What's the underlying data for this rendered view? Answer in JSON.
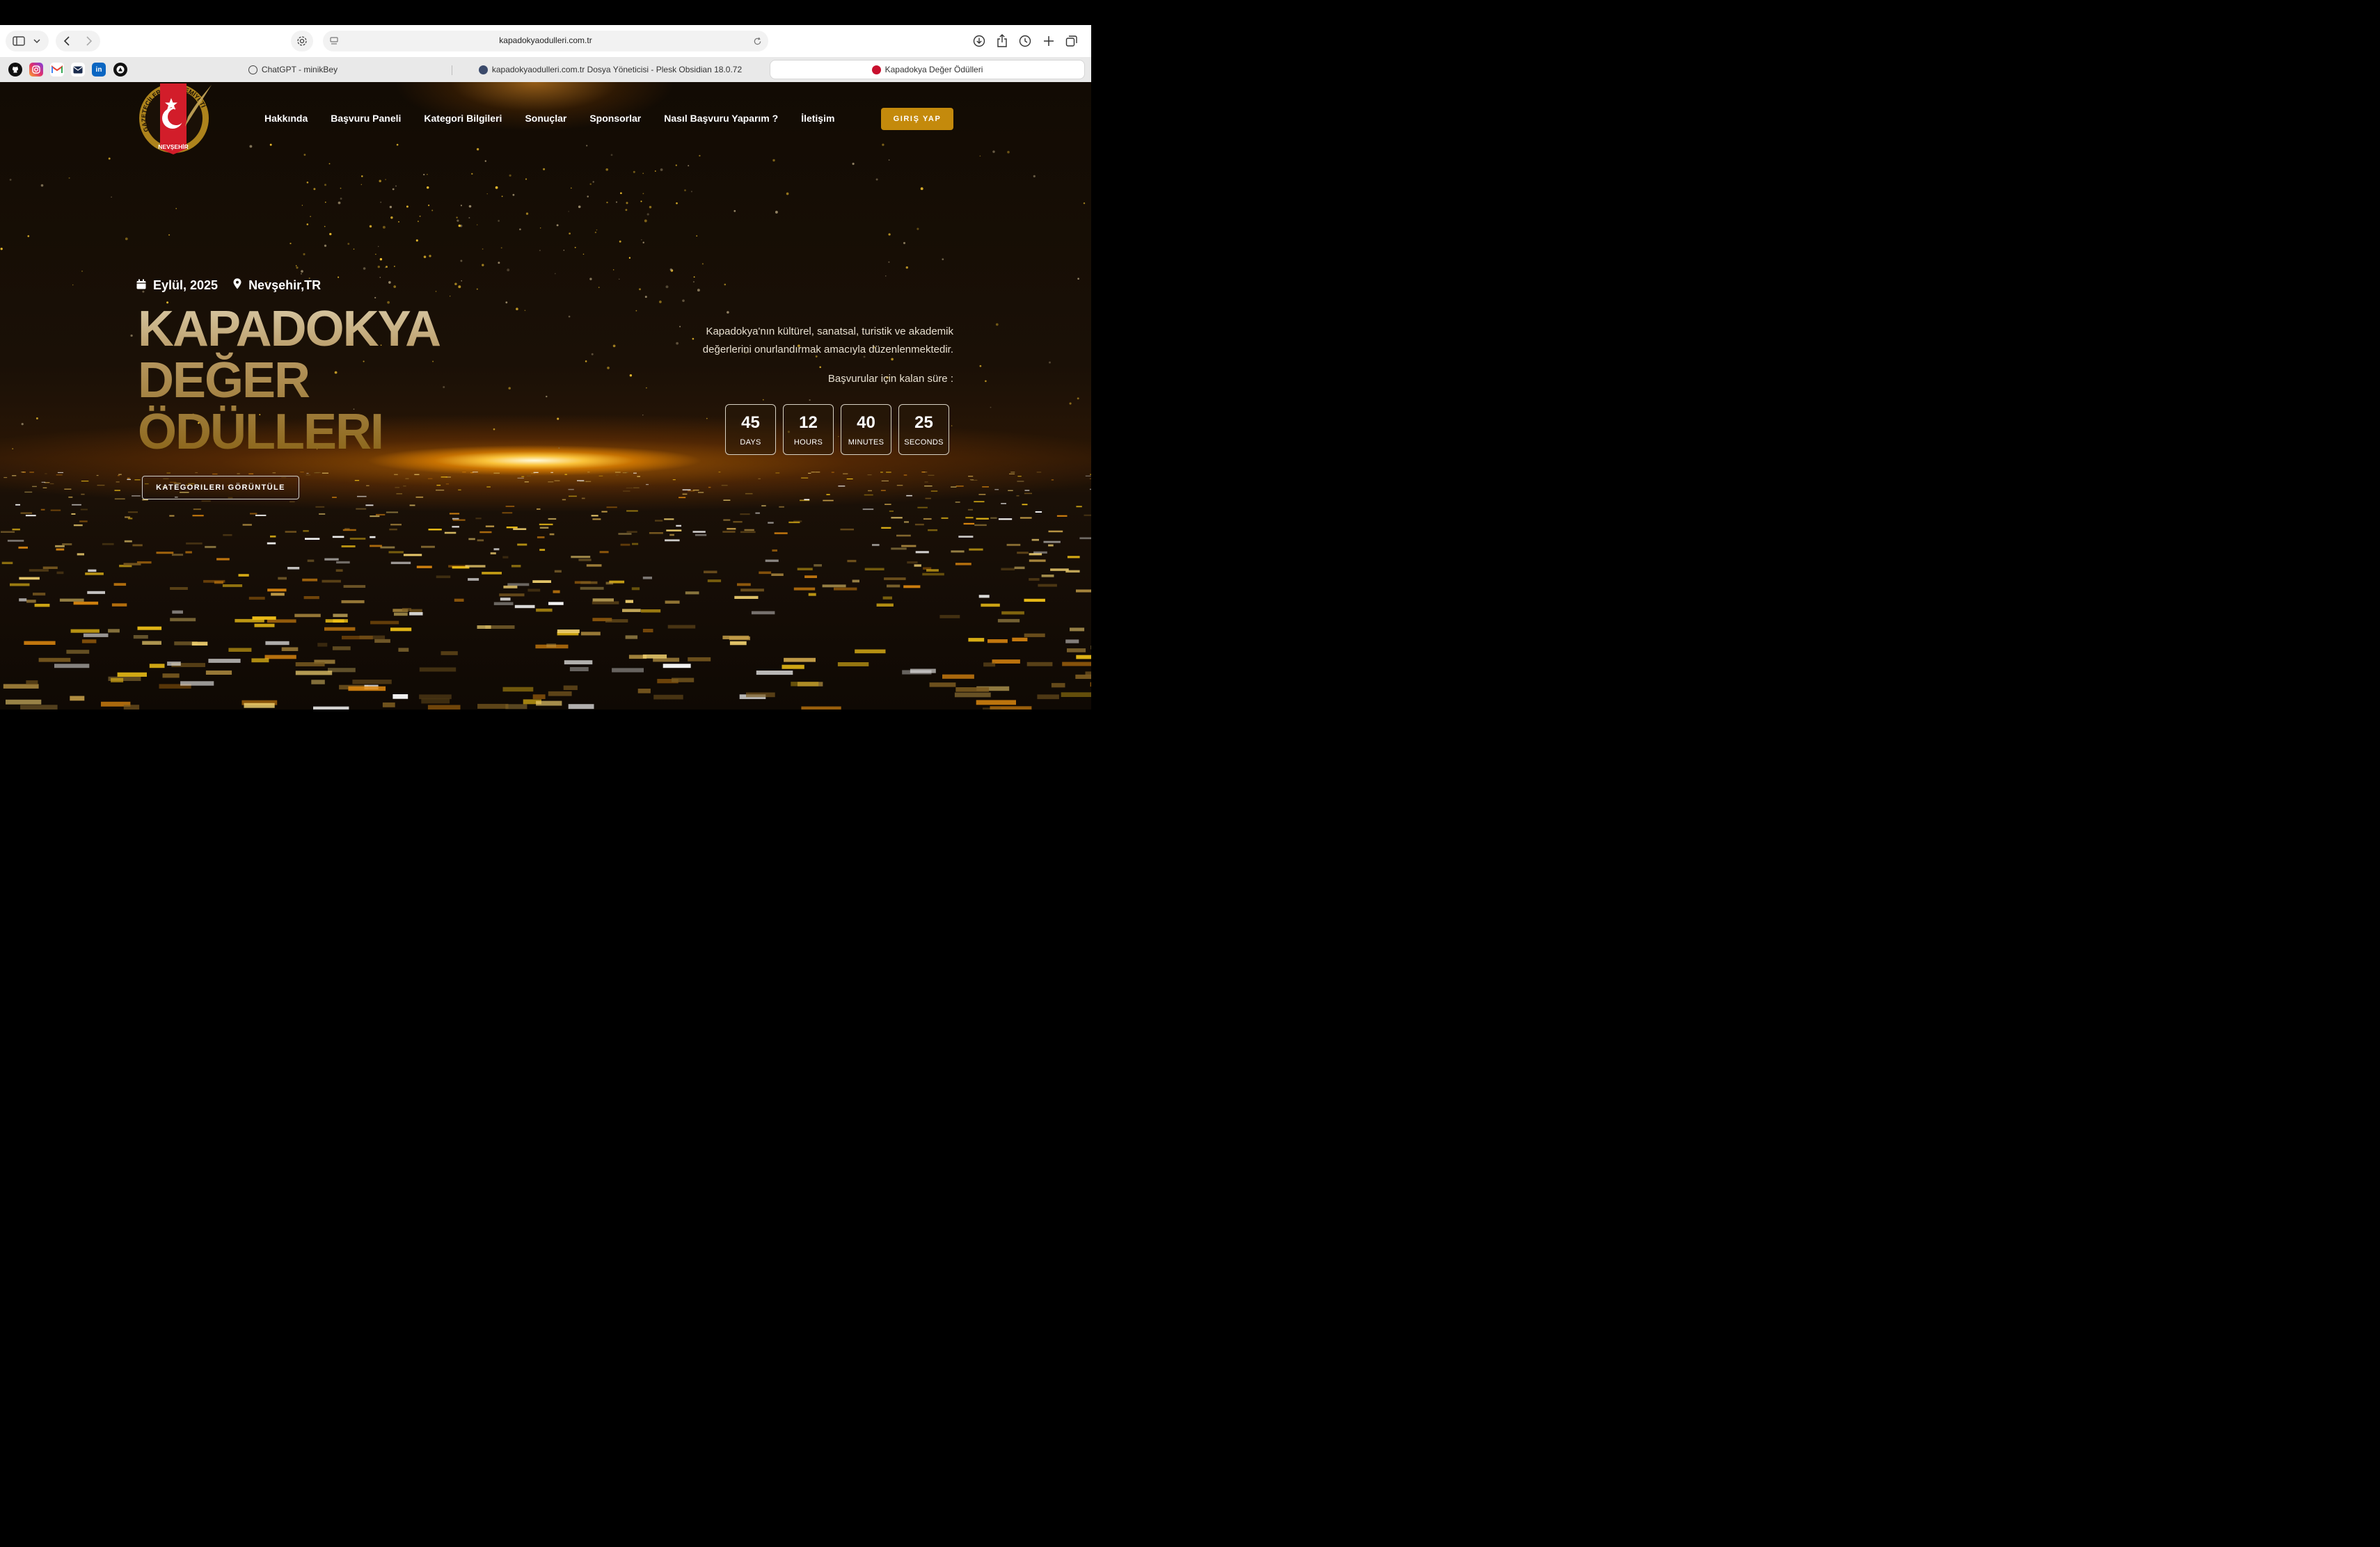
{
  "browser": {
    "url": "kapadokyaodulleri.com.tr",
    "favorites": [
      {
        "name": "github-icon",
        "label": ""
      },
      {
        "name": "instagram-icon",
        "label": ""
      },
      {
        "name": "gmail-icon",
        "label": "M"
      },
      {
        "name": "mail-icon",
        "label": ""
      },
      {
        "name": "linkedin-icon",
        "label": "in"
      },
      {
        "name": "vercel-icon",
        "label": ""
      }
    ],
    "tabs": [
      {
        "label": "ChatGPT - minikBey",
        "active": false
      },
      {
        "label": "kapadokyaodulleri.com.tr Dosya Yöneticisi - Plesk Obsidian 18.0.72",
        "active": false
      },
      {
        "label": "Kapadokya Değer Ödülleri",
        "active": true
      }
    ]
  },
  "site": {
    "nav": [
      "Hakkında",
      "Başvuru Paneli",
      "Kategori Bilgileri",
      "Sonuçlar",
      "Sponsorlar",
      "Nasıl Başvuru Yaparım ?",
      "İletişim"
    ],
    "login_label": "GIRIŞ YAP",
    "logo": {
      "arc_left": "GAZETECİLER",
      "arc_right": "CEMİYETİ",
      "banner": "NEVŞEHİR"
    },
    "date": "Eylül, 2025",
    "location": "Nevşehir,TR",
    "title_lines": [
      "KAPADOKYA",
      "DEĞER",
      "ÖDÜLLERI"
    ],
    "categories_button": "KATEGORILERI GÖRÜNTÜLE",
    "description_line1": "Kapadokya'nın kültürel, sanatsal, turistik ve akademik",
    "description_line2": "değerlerini onurlandırmak amacıyla düzenlenmektedir.",
    "remaining_label": "Başvurular için kalan süre :",
    "countdown": [
      {
        "value": "45",
        "label": "DAYS"
      },
      {
        "value": "12",
        "label": "HOURS"
      },
      {
        "value": "40",
        "label": "MINUTES"
      },
      {
        "value": "25",
        "label": "SECONDS"
      }
    ]
  },
  "colors": {
    "accent": "#c48a0c",
    "background": "#120b04",
    "glow": "#ff9a00"
  }
}
